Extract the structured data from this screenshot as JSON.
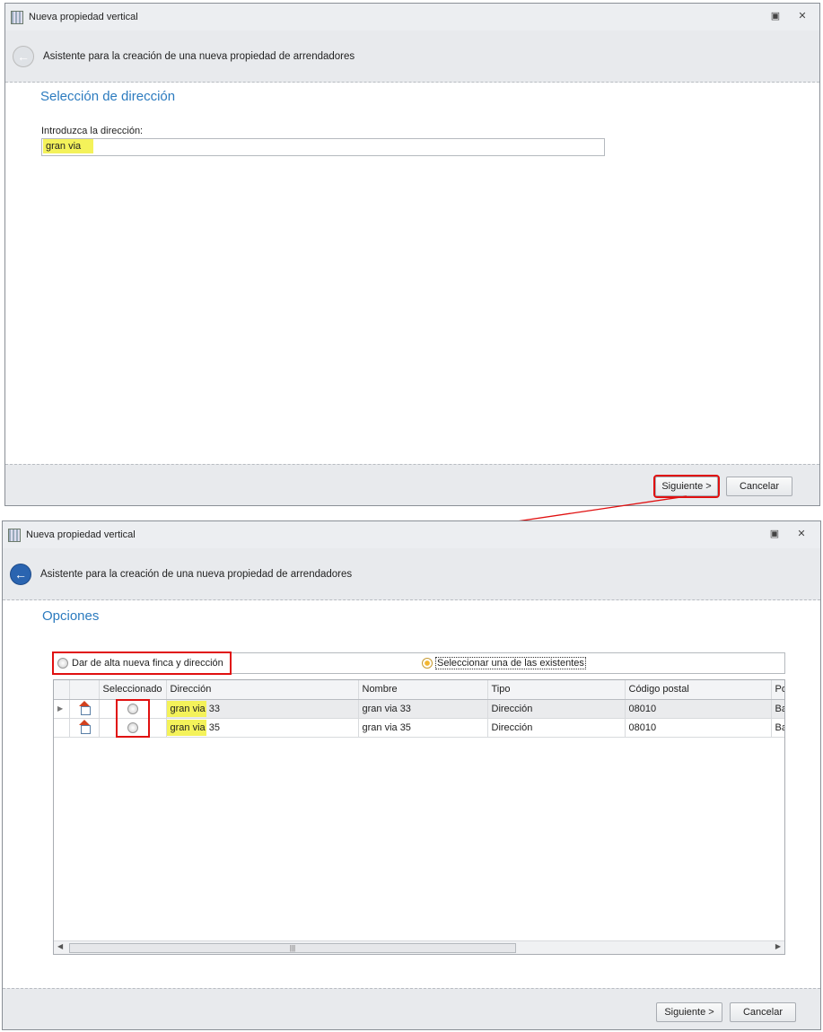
{
  "window1": {
    "title": "Nueva propiedad vertical",
    "header": "Asistente para la creación de una nueva propiedad de arrendadores",
    "section": "Selección de dirección",
    "field_label": "Introduzca la dirección:",
    "field_value": "gran via",
    "next": "Siguiente >",
    "cancel": "Cancelar"
  },
  "window2": {
    "title": "Nueva propiedad vertical",
    "header": "Asistente para la creación de una nueva propiedad de arrendadores",
    "section": "Opciones",
    "option_new": "Dar de alta nueva finca y dirección",
    "option_existing": "Seleccionar una de las existentes",
    "selected_option": "existing",
    "columns": [
      "Seleccionado",
      "Dirección",
      "Nombre",
      "Tipo",
      "Código postal",
      "Pol"
    ],
    "rows": [
      {
        "dir_match": "gran via",
        "dir_rest": " 33",
        "nombre": "gran via 33",
        "tipo": "Dirección",
        "cp": "08010",
        "pob": "Bar"
      },
      {
        "dir_match": "gran via",
        "dir_rest": " 35",
        "nombre": "gran via 35",
        "tipo": "Dirección",
        "cp": "08010",
        "pob": "Bar"
      }
    ],
    "next": "Siguiente >",
    "cancel": "Cancelar"
  },
  "colors": {
    "accent": "#2c7bbf",
    "highlight": "#f4f25a",
    "annotation": "#e01010"
  }
}
